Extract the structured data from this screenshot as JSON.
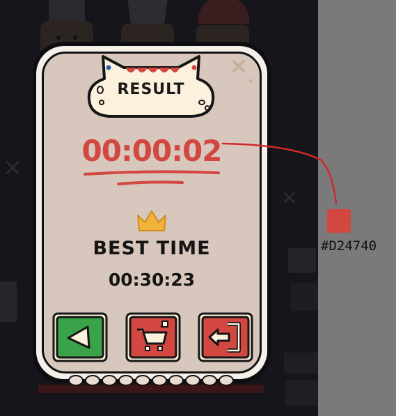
{
  "result": {
    "title": "RESULT",
    "time": "00:00:02"
  },
  "best": {
    "label": "BEST TIME",
    "value": "00:30:23"
  },
  "buttons": {
    "back_icon": "back-triangle-icon",
    "shop_icon": "shopping-cart-icon",
    "exit_icon": "exit-door-icon"
  },
  "annotation": {
    "swatch_label": "#D24740"
  },
  "colors": {
    "timer": "#d24740",
    "swatch": "#d24740",
    "crown": "#f2b33a",
    "back_button": "#3aa34a",
    "shop_button": "#d24740",
    "exit_button": "#d24740",
    "panel": "#d8c7bc",
    "side_panel": "#7a7a7a"
  }
}
